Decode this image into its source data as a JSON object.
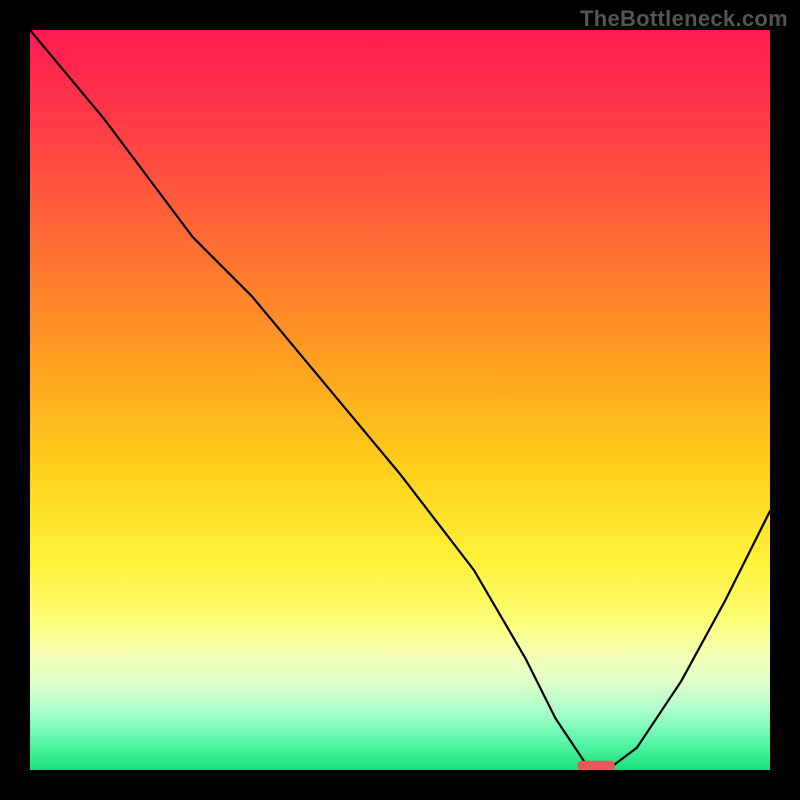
{
  "watermark": "TheBottleneck.com",
  "chart_data": {
    "type": "line",
    "title": "",
    "xlabel": "",
    "ylabel": "",
    "xlim": [
      0,
      100
    ],
    "ylim": [
      0,
      100
    ],
    "series": [
      {
        "name": "bottleneck-curve",
        "x": [
          0,
          10,
          22,
          30,
          40,
          50,
          60,
          67,
          71,
          75,
          78,
          82,
          88,
          94,
          100
        ],
        "values": [
          100,
          88,
          72,
          64,
          52,
          40,
          27,
          15,
          7,
          1,
          0,
          3,
          12,
          23,
          35
        ]
      }
    ],
    "marker": {
      "name": "optimum-indicator",
      "x_center": 76.5,
      "y": 0.5,
      "width_x": 5,
      "height_y": 1.5,
      "color": "#e85a5a"
    },
    "gradient_stops": [
      {
        "pct": 0,
        "color": "#ff1a50"
      },
      {
        "pct": 28,
        "color": "#ff6a35"
      },
      {
        "pct": 60,
        "color": "#ffd21b"
      },
      {
        "pct": 84,
        "color": "#f5ffb0"
      },
      {
        "pct": 100,
        "color": "#17e07b"
      }
    ]
  }
}
